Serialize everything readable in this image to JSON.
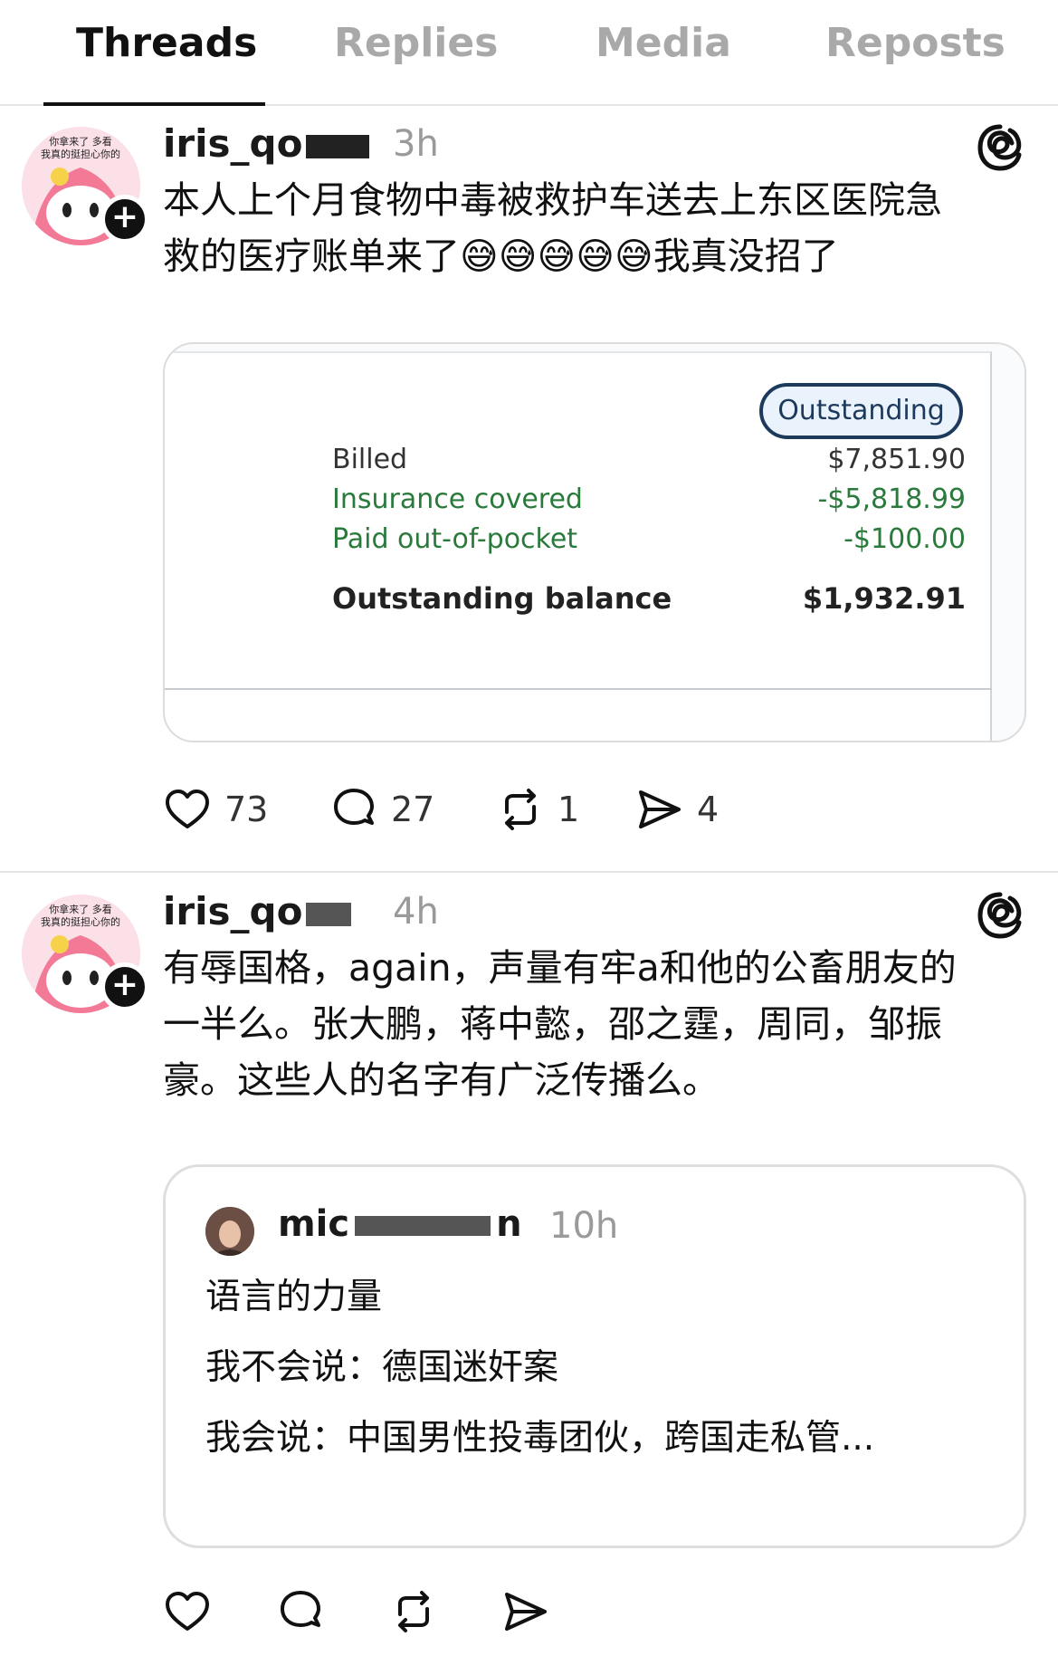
{
  "tabs": [
    {
      "label": "Threads",
      "active": true
    },
    {
      "label": "Replies",
      "active": false
    },
    {
      "label": "Media",
      "active": false
    },
    {
      "label": "Reposts",
      "active": false
    }
  ],
  "posts": [
    {
      "username": "iris_qo",
      "time": "3h",
      "text_lines": [
        "本人上个月食物中毒被救护车送去上东区医院急",
        "救的医疗账单来了😅😅😅😅😅我真没招了"
      ],
      "bill": {
        "badge": "Outstanding",
        "rows": [
          {
            "label": "Billed",
            "value": "$7,851.90"
          },
          {
            "label": "Insurance covered",
            "value": "-$5,818.99"
          },
          {
            "label": "Paid out-of-pocket",
            "value": "-$100.00"
          }
        ],
        "total_label": "Outstanding balance",
        "total_value": "$1,932.91"
      },
      "likes": "73",
      "replies": "27",
      "reposts": "1",
      "shares": "4"
    },
    {
      "username": "iris_qo",
      "time": "4h",
      "text_lines": [
        "有辱国格，again，声量有牢a和他的公畜朋友的",
        "一半么。张大鹏，蒋中懿，邵之霆，周同，邹振",
        "豪。这些人的名字有广泛传播么。"
      ],
      "quote": {
        "username": "mic",
        "username_end": "n",
        "time": "10h",
        "lines": [
          "语言的力量",
          "我不会说：德国迷奸案",
          "我会说：中国男性投毒团伙，跨国走私管..."
        ]
      }
    }
  ],
  "avatar_text": {
    "line1": "你拿来了 多看",
    "line2": "我真的挺担心你的"
  },
  "colors": {
    "accent": "#111111",
    "muted": "#9a9a9a",
    "insurance_green": "#2a7a3c",
    "badge_navy": "#1d3a5c"
  }
}
